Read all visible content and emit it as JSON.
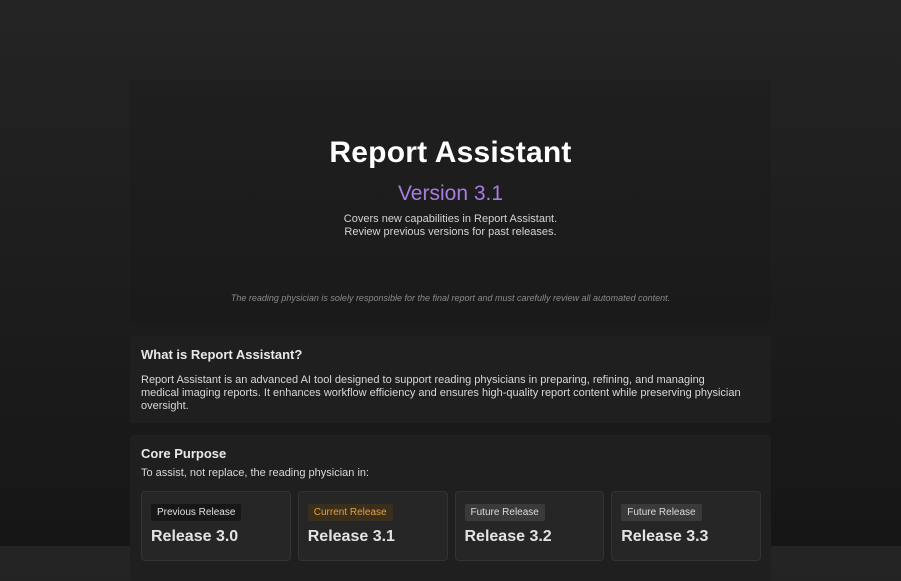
{
  "hero": {
    "title": "Report Assistant",
    "version": "Version 3.1",
    "desc_line1": "Covers new capabilities in Report Assistant.",
    "desc_line2": "Review previous versions for past releases.",
    "disclaimer": "The reading physician is solely responsible for the final report and must carefully review all automated content."
  },
  "about": {
    "heading": "What is Report Assistant?",
    "body": "Report Assistant is an advanced AI tool designed to support reading physicians in preparing, refining, and managing medical imaging reports. It enhances workflow efficiency and ensures high-quality report content while preserving physician oversight."
  },
  "core": {
    "heading": "Core Purpose",
    "subtitle": "To assist, not replace, the reading physician in:"
  },
  "releases": [
    {
      "badge": "Previous Release",
      "title": "Release 3.0"
    },
    {
      "badge": "Current Release",
      "title": "Release 3.1"
    },
    {
      "badge": "Future Release",
      "title": "Release 3.2"
    },
    {
      "badge": "Future Release",
      "title": "Release 3.3"
    }
  ],
  "colors": {
    "accent_version": "#a87de0",
    "current_badge": "#e6a23c"
  }
}
